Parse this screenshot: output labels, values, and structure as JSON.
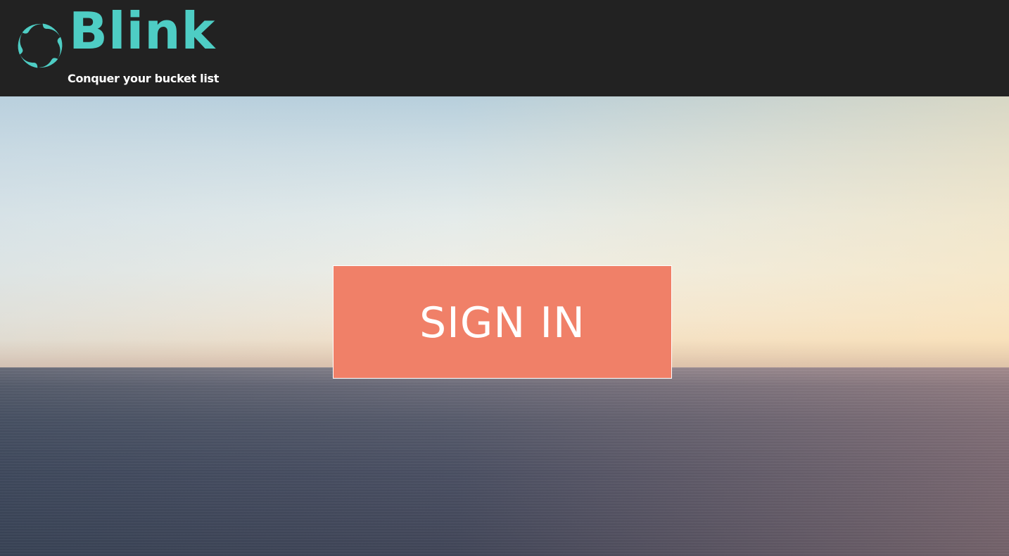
{
  "header": {
    "logo": {
      "wordmark": "Blink",
      "tagline": "Conquer your bucket list",
      "icon": "swirl-logo-icon"
    }
  },
  "hero": {
    "signin_label": "SIGN IN"
  },
  "colors": {
    "topbar_bg": "#222222",
    "brand_teal": "#4ecdc4",
    "tagline": "#ffffff",
    "signin_bg": "#f08068",
    "signin_text": "#ffffff"
  }
}
